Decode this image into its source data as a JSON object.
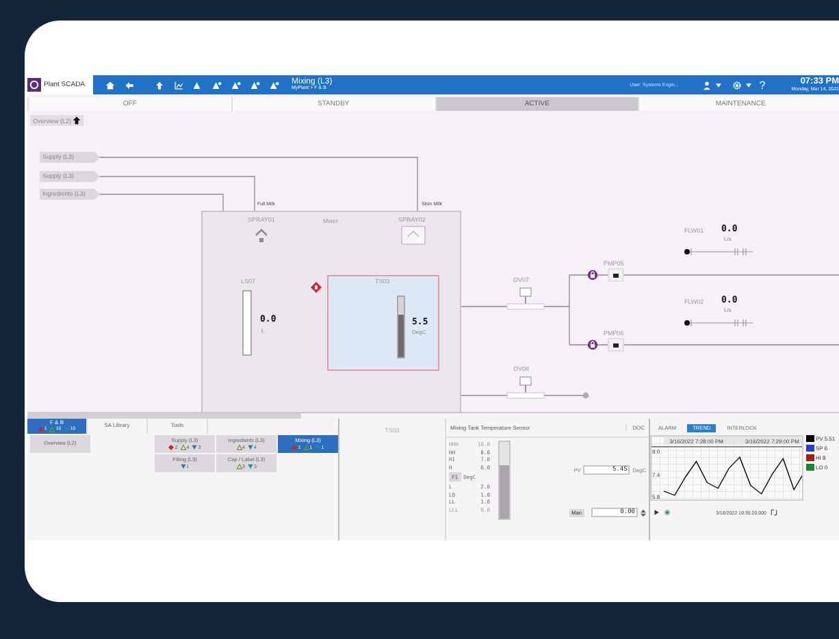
{
  "app": {
    "name": "Plant SCADA",
    "page_title": "Mixing (L3)",
    "page_path": "MyPlant > F & B",
    "user": "User: Systems Engin...",
    "help": "?",
    "time": "07:33 PM",
    "date": "Monday, Mar 14, 2022"
  },
  "modes": [
    {
      "label": "OFF",
      "selected": false
    },
    {
      "label": "STANDBY",
      "selected": false
    },
    {
      "label": "ACTIVE",
      "selected": true
    },
    {
      "label": "MAINTENANCE",
      "selected": false
    }
  ],
  "back_link": "Overview (L2)",
  "diagram": {
    "sources": [
      "Supply (L3)",
      "Supply (L3)",
      "Ingredients (L3)"
    ],
    "pipe_labels": [
      "Full Milk",
      "Skim Milk"
    ],
    "tank": {
      "title": "Mixer",
      "sprays": [
        "SPRAY01",
        "SPRAY02"
      ],
      "level_sensor": {
        "tag": "LS07",
        "value": "0.0",
        "unit": "L"
      },
      "temperature": {
        "tag": "TS03",
        "value": "5.5",
        "unit": "DegC",
        "level": 0.7,
        "alarm": true
      }
    },
    "valves": [
      {
        "tag": "OV07"
      },
      {
        "tag": "OV08"
      }
    ],
    "pumps": [
      {
        "tag": "PMP05",
        "locked": true
      },
      {
        "tag": "PMP06",
        "locked": true
      }
    ],
    "flows": [
      {
        "tag": "FLW01",
        "value": "0.0",
        "unit": "L/s"
      },
      {
        "tag": "FLW02",
        "value": "0.0",
        "unit": "L/s"
      }
    ]
  },
  "navigator": {
    "tabs": [
      {
        "label": "F & B",
        "selected": true,
        "counts": [
          {
            "kind": "critical",
            "value": "1"
          },
          {
            "kind": "warning",
            "value": "10"
          },
          {
            "kind": "info",
            "value": "10"
          }
        ]
      },
      {
        "label": "SA Library",
        "selected": false
      },
      {
        "label": "Tools",
        "selected": false
      }
    ],
    "overview": {
      "label": "Overview (L2)",
      "selected": false
    },
    "areas": [
      {
        "label": "Supply (L3)",
        "selected": false,
        "counts": [
          {
            "kind": "critical",
            "value": "2"
          },
          {
            "kind": "warning",
            "value": "4"
          },
          {
            "kind": "info",
            "value": "3"
          }
        ]
      },
      {
        "label": "Ingredients (L3)",
        "selected": false,
        "counts": [
          {
            "kind": "warning",
            "value": "4"
          },
          {
            "kind": "info",
            "value": "4"
          }
        ]
      },
      {
        "label": "Mixing (L3)",
        "selected": true,
        "counts": [
          {
            "kind": "critical",
            "value": "1"
          },
          {
            "kind": "warning",
            "value": "1"
          },
          {
            "kind": "info",
            "value": "1"
          }
        ]
      },
      {
        "label": "Filling (L3)",
        "selected": false,
        "counts": [
          {
            "kind": "info",
            "value": "1"
          }
        ]
      },
      {
        "label": "Cap / Label (L3)",
        "selected": false,
        "counts": [
          {
            "kind": "warning",
            "value": "3"
          },
          {
            "kind": "info",
            "value": "3"
          }
        ]
      }
    ]
  },
  "selected_tag": "TS03",
  "faceplate": {
    "description": "Mixing Tank Temperature Sensor",
    "doc": "DOC",
    "upper_limits": [
      {
        "label": "HHH",
        "value": "10.0",
        "disabled": true
      },
      {
        "label": "HH",
        "value": "8.0",
        "disabled": false
      },
      {
        "label": "HI",
        "value": "7.0",
        "disabled": false
      },
      {
        "label": "H",
        "value": "6.0",
        "disabled": false
      }
    ],
    "unit_button": "F1",
    "unit": "DegC",
    "lower_limits": [
      {
        "label": "L",
        "value": "2.0",
        "disabled": false
      },
      {
        "label": "LO",
        "value": "1.0",
        "disabled": false
      },
      {
        "label": "LL",
        "value": "1.0",
        "disabled": false
      },
      {
        "label": "LLL",
        "value": "0.0",
        "disabled": true
      }
    ],
    "level": 0.7,
    "pv_label": "PV",
    "pv": "5.45",
    "pv_unit": "DegC",
    "mode_button": "Man",
    "output": "0.00"
  },
  "trend": {
    "tabs": [
      {
        "label": "ALARM",
        "selected": false
      },
      {
        "label": "TREND",
        "selected": true
      },
      {
        "label": "INTERLOCK",
        "selected": false
      }
    ],
    "chart_data": {
      "type": "line",
      "categories": [
        null,
        null,
        null,
        "3/16/2022 7:28:00 PM",
        null,
        null,
        null,
        null,
        null,
        null,
        "3/16/2022 7:29:00 PM",
        null,
        null,
        null
      ],
      "ylim": [
        5.8,
        9.0
      ],
      "yticks": [
        {
          "value": 9.0,
          "label": "9.0"
        },
        {
          "value": 7.4,
          "label": "7.4"
        },
        {
          "value": 5.8,
          "label": "5.8"
        }
      ],
      "series": [
        {
          "color": "#000000",
          "values": [
            6.2,
            5.9,
            7.2,
            8.3,
            6.8,
            6.4,
            7.8,
            8.6,
            6.6,
            6.0,
            7.4,
            8.5,
            6.3,
            7.6
          ]
        }
      ]
    },
    "legend": [
      {
        "name": "PV",
        "color": "#000000",
        "value": "5.51"
      },
      {
        "name": "SP",
        "color": "#1d3fd8",
        "value": "6"
      },
      {
        "name": "HI",
        "color": "#a0200a",
        "value": "8"
      },
      {
        "name": "LO",
        "color": "#138a2a",
        "value": "0"
      }
    ],
    "timestamp": "3/16/2022 19:35:20.000"
  }
}
